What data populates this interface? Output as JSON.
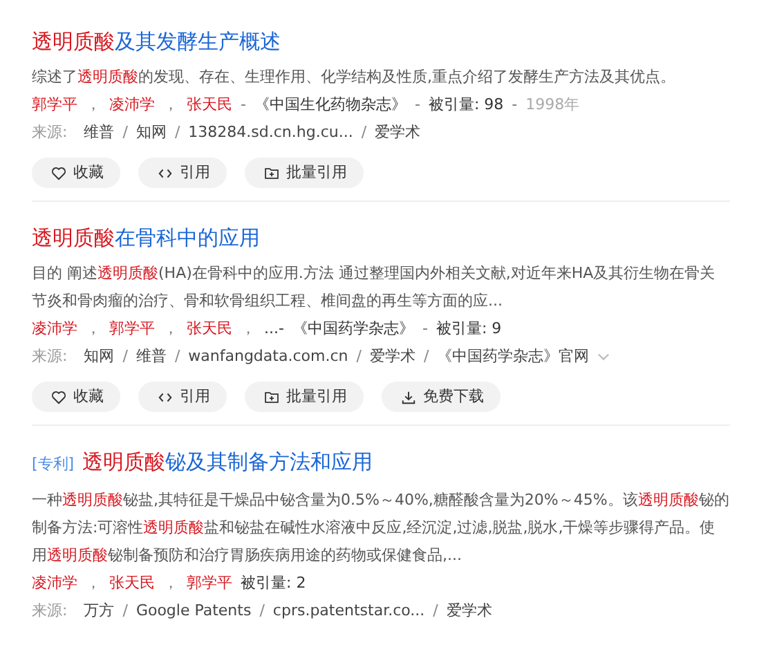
{
  "results": [
    {
      "title": [
        {
          "text": "透明质酸",
          "hl": true
        },
        {
          "text": "及其发酵生产概述",
          "hl": false
        }
      ],
      "abstract": [
        {
          "text": "综述了",
          "hl": false
        },
        {
          "text": "透明质酸",
          "hl": true
        },
        {
          "text": "的发现、存在、生理作用、化学结构及性质,重点介绍了发酵生产方法及其优点。",
          "hl": false
        }
      ],
      "meta": [
        {
          "kind": "author",
          "text": "郭学平"
        },
        {
          "kind": "sep",
          "text": "，"
        },
        {
          "kind": "author",
          "text": "凌沛学"
        },
        {
          "kind": "sep",
          "text": "，"
        },
        {
          "kind": "author",
          "text": "张天民"
        },
        {
          "kind": "sep",
          "text": "-"
        },
        {
          "kind": "info",
          "text": "《中国生化药物杂志》"
        },
        {
          "kind": "sep",
          "text": "-"
        },
        {
          "kind": "info",
          "text": "被引量: 98"
        },
        {
          "kind": "sep",
          "text": "-"
        },
        {
          "kind": "muted",
          "text": "1998年"
        }
      ],
      "source_label": "来源:",
      "sources": [
        {
          "kind": "link",
          "text": "维普"
        },
        {
          "kind": "sep",
          "text": "/"
        },
        {
          "kind": "link",
          "text": "知网"
        },
        {
          "kind": "sep",
          "text": "/"
        },
        {
          "kind": "link",
          "text": "138284.sd.cn.hg.cu..."
        },
        {
          "kind": "sep",
          "text": "/"
        },
        {
          "kind": "link",
          "text": "爱学术"
        }
      ],
      "buttons": [
        {
          "kind": "collect",
          "label": "收藏"
        },
        {
          "kind": "cite",
          "label": "引用"
        },
        {
          "kind": "batch",
          "label": "批量引用"
        }
      ]
    },
    {
      "title": [
        {
          "text": "透明质酸",
          "hl": true
        },
        {
          "text": "在骨科中的应用",
          "hl": false
        }
      ],
      "abstract": [
        {
          "text": "目的 阐述",
          "hl": false
        },
        {
          "text": "透明质酸",
          "hl": true
        },
        {
          "text": "(HA)在骨科中的应用.方法 通过整理国内外相关文献,对近年来HA及其衍生物在骨关节炎和骨肉瘤的治疗、骨和软骨组织工程、椎间盘的再生等方面的应...",
          "hl": false
        }
      ],
      "meta": [
        {
          "kind": "author",
          "text": "凌沛学"
        },
        {
          "kind": "sep",
          "text": "，"
        },
        {
          "kind": "author",
          "text": "郭学平"
        },
        {
          "kind": "sep",
          "text": "，"
        },
        {
          "kind": "author",
          "text": "张天民"
        },
        {
          "kind": "sep",
          "text": "，"
        },
        {
          "kind": "info",
          "text": "...-"
        },
        {
          "kind": "info",
          "text": "《中国药学杂志》"
        },
        {
          "kind": "sep",
          "text": "-"
        },
        {
          "kind": "info",
          "text": "被引量: 9"
        }
      ],
      "source_label": "来源:",
      "sources": [
        {
          "kind": "link",
          "text": "知网"
        },
        {
          "kind": "sep",
          "text": "/"
        },
        {
          "kind": "link",
          "text": "维普"
        },
        {
          "kind": "sep",
          "text": "/"
        },
        {
          "kind": "link",
          "text": "wanfangdata.com.cn"
        },
        {
          "kind": "sep",
          "text": "/"
        },
        {
          "kind": "link",
          "text": "爱学术"
        },
        {
          "kind": "sep",
          "text": "/"
        },
        {
          "kind": "link",
          "text": "《中国药学杂志》官网"
        }
      ],
      "expandable": true,
      "buttons": [
        {
          "kind": "collect",
          "label": "收藏"
        },
        {
          "kind": "cite",
          "label": "引用"
        },
        {
          "kind": "batch",
          "label": "批量引用"
        },
        {
          "kind": "download",
          "label": "免费下载"
        }
      ]
    },
    {
      "tag": "[专利]",
      "title": [
        {
          "text": "透明质酸",
          "hl": true
        },
        {
          "text": "铋及其制备方法和应用",
          "hl": false
        }
      ],
      "abstract": [
        {
          "text": "一种",
          "hl": false
        },
        {
          "text": "透明质酸",
          "hl": true
        },
        {
          "text": "铋盐,其特征是干燥品中铋含量为0.5%～40%,糖醛酸含量为20%～45%。该",
          "hl": false
        },
        {
          "text": "透明质酸",
          "hl": true
        },
        {
          "text": "铋的制备方法:可溶性",
          "hl": false
        },
        {
          "text": "透明质酸",
          "hl": true
        },
        {
          "text": "盐和铋盐在碱性水溶液中反应,经沉淀,过滤,脱盐,脱水,干燥等步骤得产品。使用",
          "hl": false
        },
        {
          "text": "透明质酸",
          "hl": true
        },
        {
          "text": "铋制备预防和治疗胃肠疾病用途的药物或保健食品,...",
          "hl": false
        }
      ],
      "meta": [
        {
          "kind": "author",
          "text": "凌沛学"
        },
        {
          "kind": "sep",
          "text": "，"
        },
        {
          "kind": "author",
          "text": "张天民"
        },
        {
          "kind": "sep",
          "text": "，"
        },
        {
          "kind": "author",
          "text": "郭学平"
        },
        {
          "kind": "info",
          "text": "被引量: 2"
        }
      ],
      "source_label": "来源:",
      "sources": [
        {
          "kind": "link",
          "text": "万方"
        },
        {
          "kind": "sep",
          "text": "/"
        },
        {
          "kind": "link",
          "text": "Google Patents"
        },
        {
          "kind": "sep",
          "text": "/"
        },
        {
          "kind": "link",
          "text": "cprs.patentstar.co..."
        },
        {
          "kind": "sep",
          "text": "/"
        },
        {
          "kind": "link",
          "text": "爱学术"
        }
      ]
    }
  ]
}
